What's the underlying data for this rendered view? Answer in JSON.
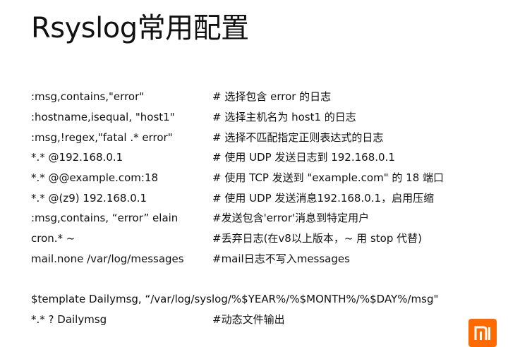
{
  "title": "Rsyslog常用配置",
  "config_lines": [
    {
      "command": ":msg,contains,\"error\"",
      "comment": "# 选择包含 error 的日志"
    },
    {
      "command": ":hostname,isequal, \"host1\"",
      "comment": "# 选择主机名为 host1 的日志"
    },
    {
      "command": ":msg,!regex,\"fatal .* error\"",
      "comment": "# 选择不匹配指定正则表达式的日志"
    },
    {
      "command": "*.* @192.168.0.1",
      "comment": "# 使用 UDP 发送日志到 192.168.0.1"
    },
    {
      "command": "*.* @@example.com:18",
      "comment": "# 使用 TCP 发送到 \"example.com\" 的 18 端口"
    },
    {
      "command": "*.* @(z9) 192.168.0.1",
      "comment": "# 使用 UDP 发送消息192.168.0.1，启用压缩"
    },
    {
      "command": ":msg,contains, “error” elain",
      "comment": "#发送包含'error'消息到特定用户"
    },
    {
      "command": "cron.* ~",
      "comment": "#丢弃日志(在v8以上版本，~ 用 stop 代替)"
    },
    {
      "command": "mail.none  /var/log/messages",
      "comment": "#mail日志不写入messages"
    }
  ],
  "template_line": "$template Dailymsg, “/var/log/syslog/%$YEAR%/%$MONTH%/%$DAY%/msg\"",
  "last_line": {
    "command": "*.* ? Dailymsg",
    "comment": "#动态文件输出"
  },
  "logo": {
    "icon": "mi-logo",
    "color": "#ff6a00"
  }
}
